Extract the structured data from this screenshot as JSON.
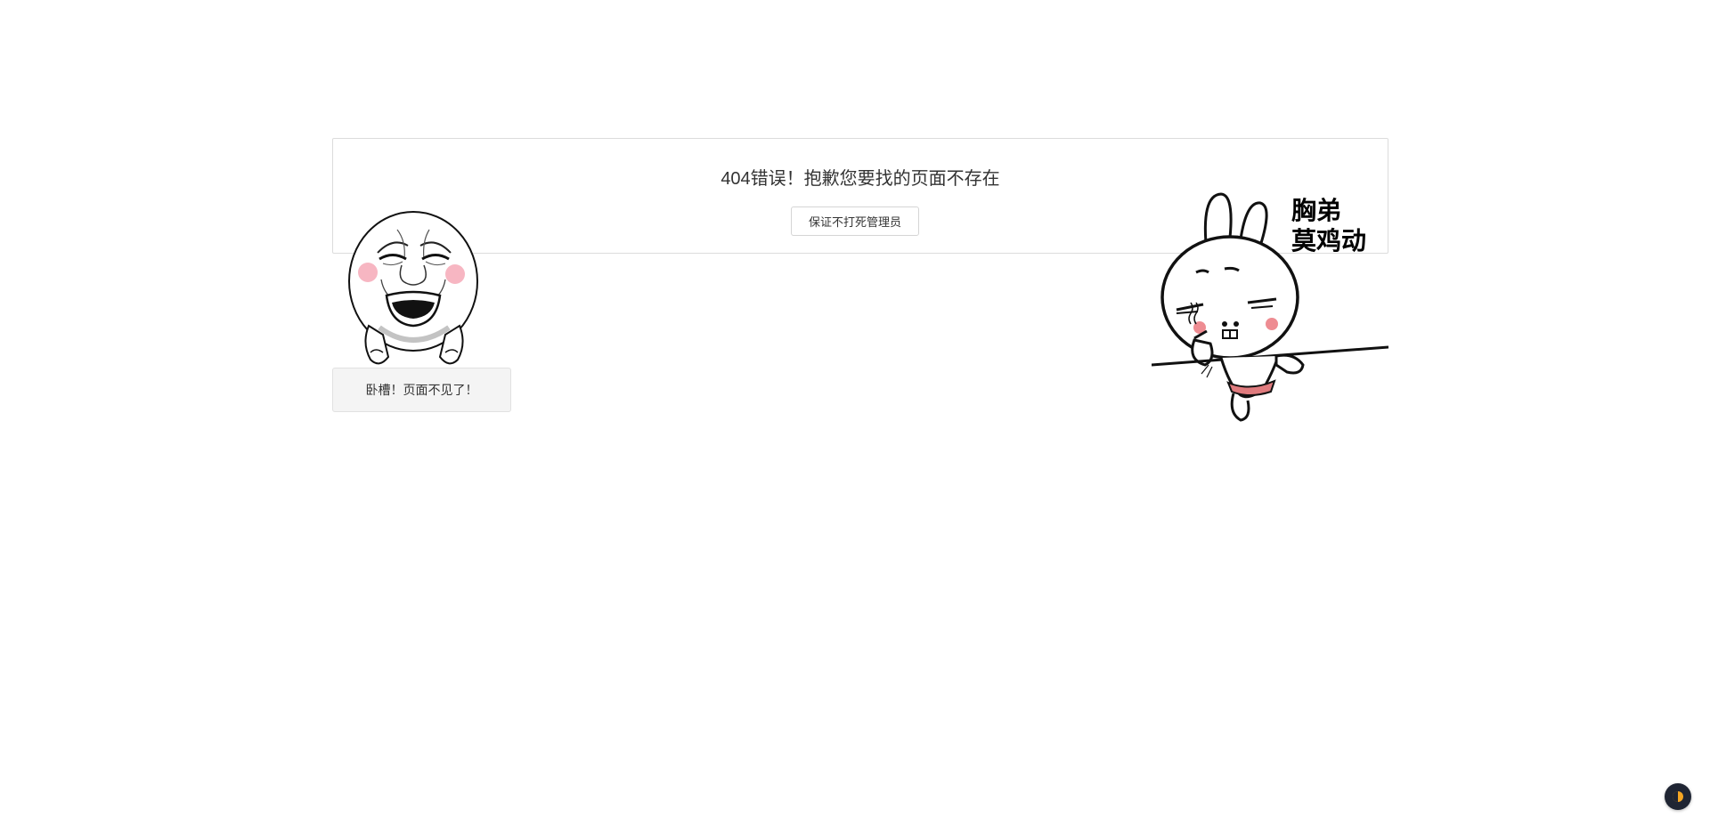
{
  "error": {
    "title": "404错误！抱歉您要找的页面不存在",
    "admin_button_label": "保证不打死管理员"
  },
  "meme": {
    "speech": "卧槽！页面不见了！"
  },
  "rabbit": {
    "caption_line1": "胸弟",
    "caption_line2": "莫鸡动"
  },
  "theme_toggle": {
    "icon": "half-moon-icon",
    "accent": "#f5a623"
  }
}
